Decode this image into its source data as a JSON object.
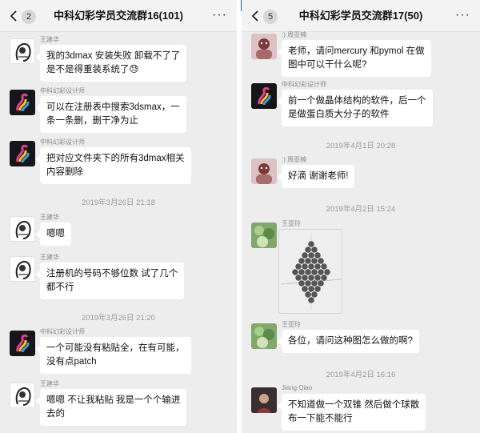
{
  "left": {
    "badge": "2",
    "title": "中科幻彩学员交流群16(101)",
    "more": "···",
    "messages": [
      {
        "sender": "王建华",
        "lines": [
          "我的3dmax 安装失败 卸载不了了",
          "是不是得重装系统了😓"
        ]
      },
      {
        "sender": "中科幻彩设计师",
        "lines": [
          "可以在注册表中搜索3dsmax，一",
          "条一条删，删干净为止"
        ]
      },
      {
        "sender": "中科幻彩设计师",
        "lines": [
          "把对应文件夹下的所有3dmax相关",
          "内容删除"
        ]
      },
      {
        "time": "2019年3月26日 21:18"
      },
      {
        "sender": "王建华",
        "lines": [
          "嗯嗯"
        ]
      },
      {
        "sender": "王建华",
        "lines": [
          "注册机的号码不够位数 试了几个",
          "都不行"
        ]
      },
      {
        "time": "2019年3月26日 21:20"
      },
      {
        "sender": "中科幻彩设计师",
        "lines": [
          "一个可能没有粘贴全，在有可能，",
          "没有点patch"
        ]
      },
      {
        "sender": "王建华",
        "lines": [
          "嗯嗯 不让我粘贴 我是一个个输进",
          "去的"
        ]
      }
    ]
  },
  "right": {
    "badge": "5",
    "title": "中科幻彩学员交流群17(50)",
    "more": "···",
    "messages": [
      {
        "sender": ":) 周亚楠",
        "lines": [
          "老师，请问mercury 和pymol 在做",
          "图中可以干什么呢?"
        ]
      },
      {
        "sender": "中科幻彩设计师",
        "lines": [
          "前一个做晶体结构的软件，后一个",
          "是做蛋白质大分子的软件"
        ]
      },
      {
        "time": "2019年4月1日 20:28"
      },
      {
        "sender": ":) 周亚楠",
        "lines": [
          "好滴   谢谢老师!"
        ]
      },
      {
        "time": "2019年4月2日 15:24"
      },
      {
        "sender": "王亚玲"
      },
      {
        "sender": "王亚玲",
        "lines": [
          "各位，请问这种图怎么做的啊?"
        ]
      },
      {
        "time": "2019年4月2日 16:16"
      },
      {
        "sender": "Jiang Qiao",
        "lines": [
          "不知道做一个双锥 然后做个球散",
          "布一下能不能行"
        ]
      }
    ]
  }
}
